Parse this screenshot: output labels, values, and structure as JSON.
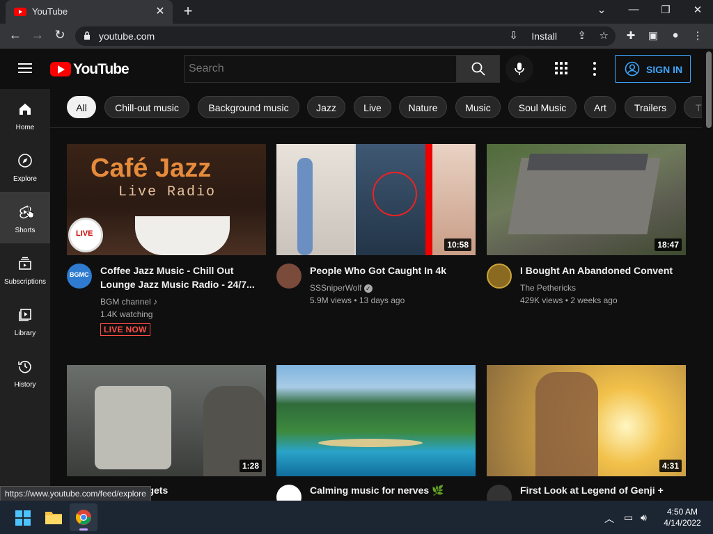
{
  "browser": {
    "tab_title": "YouTube",
    "url": "youtube.com",
    "install_label": "Install",
    "status_url": "https://www.youtube.com/feed/explore"
  },
  "header": {
    "logo_text": "YouTube",
    "search_placeholder": "Search",
    "sign_in_label": "SIGN IN"
  },
  "sidebar": {
    "items": [
      {
        "label": "Home",
        "icon": "home-icon"
      },
      {
        "label": "Explore",
        "icon": "compass-icon"
      },
      {
        "label": "Shorts",
        "icon": "shorts-icon"
      },
      {
        "label": "Subscriptions",
        "icon": "subscriptions-icon"
      },
      {
        "label": "Library",
        "icon": "library-icon"
      },
      {
        "label": "History",
        "icon": "history-icon"
      }
    ]
  },
  "chips": [
    "All",
    "Chill-out music",
    "Background music",
    "Jazz",
    "Live",
    "Nature",
    "Music",
    "Soul Music",
    "Art",
    "Trailers",
    "Th"
  ],
  "videos": [
    {
      "title": "Coffee Jazz Music - Chill Out Lounge Jazz Music Radio - 24/7...",
      "channel": "BGM channel",
      "meta": "1.4K watching",
      "badge": "LIVE NOW",
      "thumb_title": "Café Jazz",
      "thumb_sub": "Live Radio",
      "thumb_live": "LIVE",
      "avatar_text": "BGMC"
    },
    {
      "title": "People Who Got Caught In 4k",
      "channel": "SSSniperWolf",
      "meta": "5.9M views • 13 days ago",
      "duration": "10:58"
    },
    {
      "title": "I Bought An Abandoned Convent",
      "channel": "The Pethericks",
      "meta": "429K views • 2 weeks ago",
      "duration": "18:47"
    },
    {
      "title": "Cab robbery gets",
      "title_visible": "b robbery gets",
      "duration": "1:28"
    },
    {
      "title": "Calming music for nerves 🌿",
      "duration": ""
    },
    {
      "title": "First Look at Legend of Genji +",
      "duration": "4:31"
    }
  ],
  "taskbar": {
    "time": "4:50 AM",
    "date": "4/14/2022"
  },
  "colors": {
    "bg": "#0f0f0f",
    "accent_red": "#ff0000",
    "sign_in_blue": "#3ea6ff"
  }
}
